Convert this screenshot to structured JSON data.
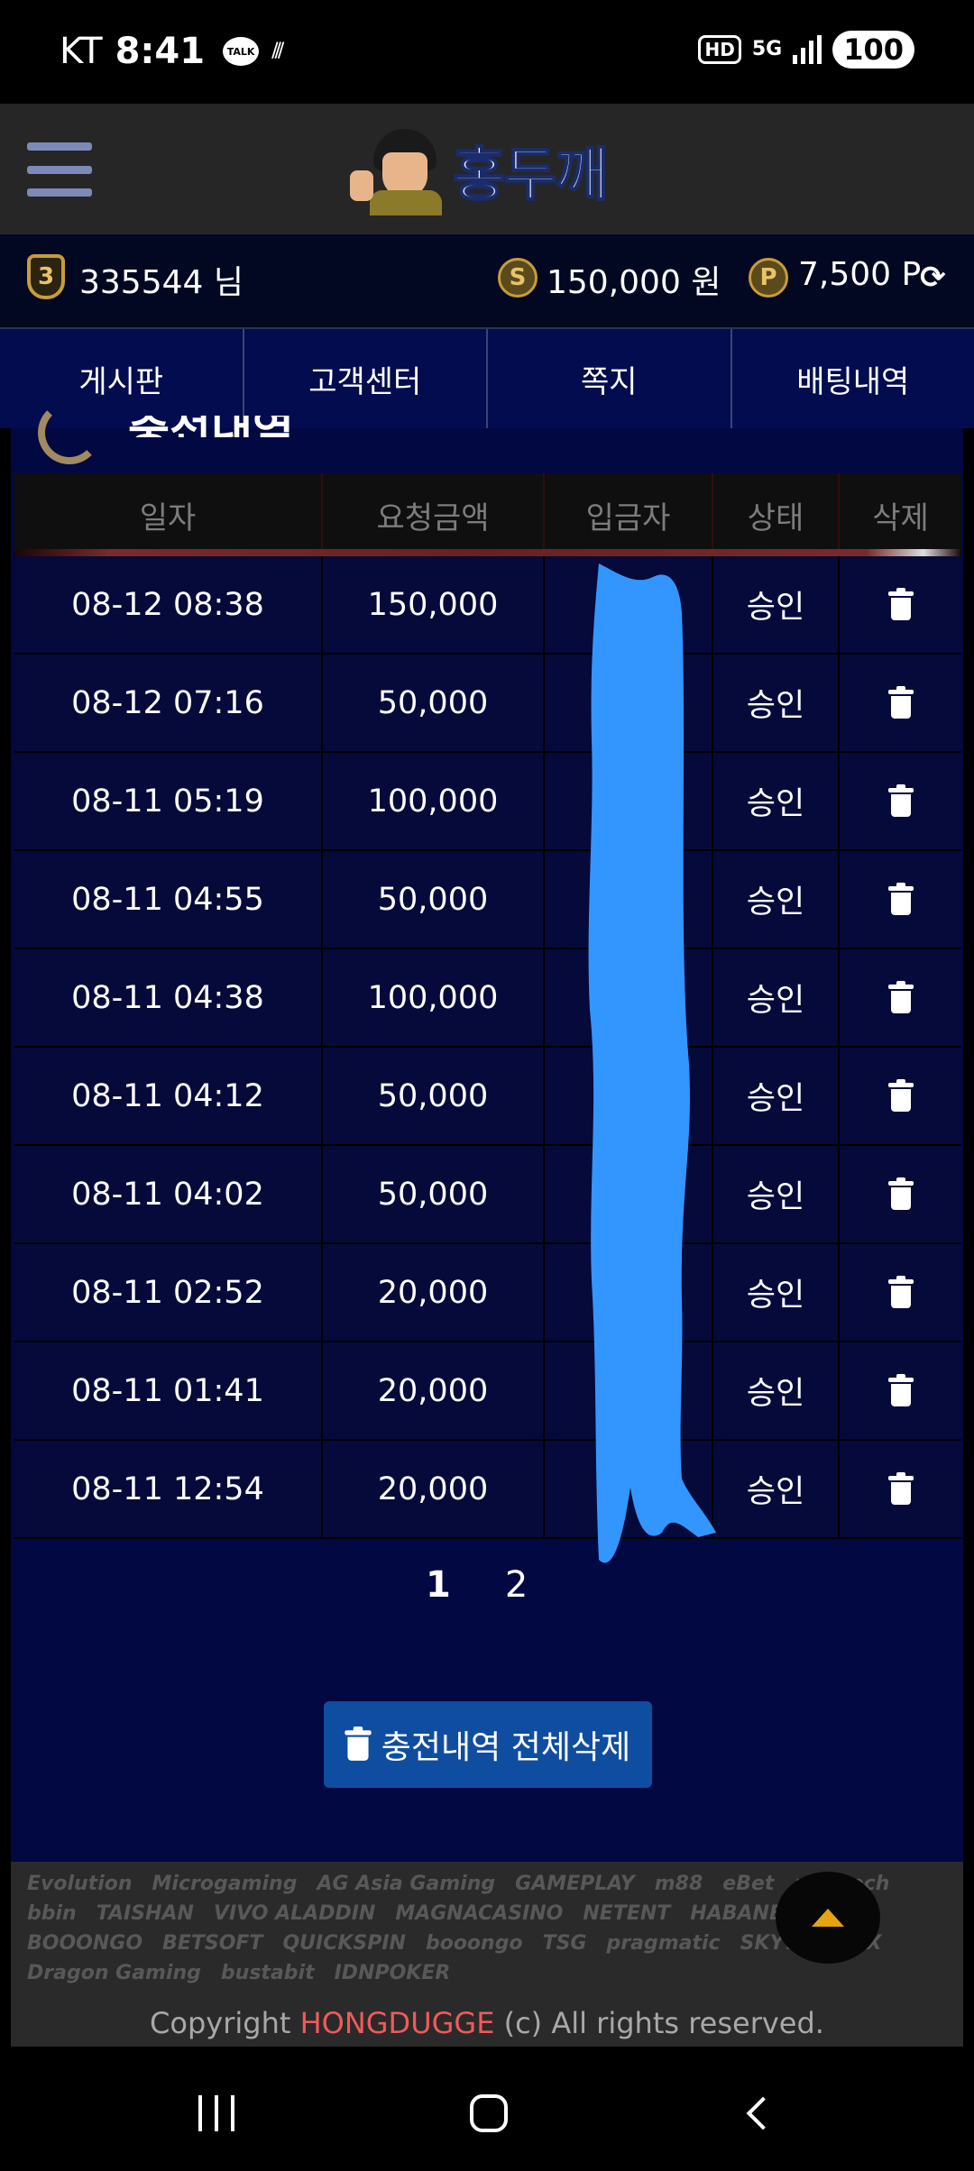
{
  "status_bar": {
    "carrier": "KT",
    "time": "8:41",
    "talk_badge": "TALK",
    "hd_label": "HD",
    "network_label": "5G",
    "battery": "100"
  },
  "header": {
    "logo_text": "홍두깨"
  },
  "user_bar": {
    "level": "3",
    "username": "335544 님",
    "money": "150,000 원",
    "points": "7,500 P",
    "money_icon_label": "S",
    "points_icon_label": "P"
  },
  "nav": {
    "items": [
      "게시판",
      "고객센터",
      "쪽지",
      "배팅내역"
    ]
  },
  "page": {
    "section_title": "충전내역"
  },
  "table": {
    "headers": [
      "일자",
      "요청금액",
      "입금자",
      "상태",
      "삭제"
    ],
    "rows": [
      {
        "date": "08-12 08:38",
        "amount": "150,000",
        "depositor": "",
        "status": "승인"
      },
      {
        "date": "08-12 07:16",
        "amount": "50,000",
        "depositor": "",
        "status": "승인"
      },
      {
        "date": "08-11 05:19",
        "amount": "100,000",
        "depositor": "",
        "status": "승인"
      },
      {
        "date": "08-11 04:55",
        "amount": "50,000",
        "depositor": "",
        "status": "승인"
      },
      {
        "date": "08-11 04:38",
        "amount": "100,000",
        "depositor": "",
        "status": "승인"
      },
      {
        "date": "08-11 04:12",
        "amount": "50,000",
        "depositor": "",
        "status": "승인"
      },
      {
        "date": "08-11 04:02",
        "amount": "50,000",
        "depositor": "",
        "status": "승인"
      },
      {
        "date": "08-11 02:52",
        "amount": "20,000",
        "depositor": "",
        "status": "승인"
      },
      {
        "date": "08-11 01:41",
        "amount": "20,000",
        "depositor": "",
        "status": "승인"
      },
      {
        "date": "08-11 12:54",
        "amount": "20,000",
        "depositor": "",
        "status": "승인"
      }
    ]
  },
  "pagination": {
    "pages": [
      "1",
      "2"
    ],
    "current": "1"
  },
  "actions": {
    "delete_all_label": "충전내역 전체삭제"
  },
  "footer": {
    "providers": [
      "Evolution",
      "Microgaming",
      "AG Asia Gaming",
      "GAMEPLAY",
      "m88",
      "eBet",
      "playtech",
      "bbin",
      "TAISHAN",
      "VIVO ALADDIN",
      "MAGNACASINO",
      "NETENT",
      "HABANERO",
      "BOOONGO",
      "BETSOFT",
      "QUICKSPIN",
      "booongo",
      "TSG",
      "pragmatic",
      "SKYWIND",
      "X",
      "Dragon Gaming",
      "bustabit",
      "IDNPOKER"
    ],
    "copyright_prefix": "Copyright ",
    "brand": "HONGDUGGE",
    "copyright_suffix": " (c) All rights reserved."
  },
  "colors": {
    "nav_bg": "#020c4e",
    "panel_bg": "#020841",
    "accent_gold": "#c89c3a",
    "button_blue": "#0f4da0",
    "brand_red": "#f05a5a",
    "redaction_blue": "#3396ff"
  }
}
